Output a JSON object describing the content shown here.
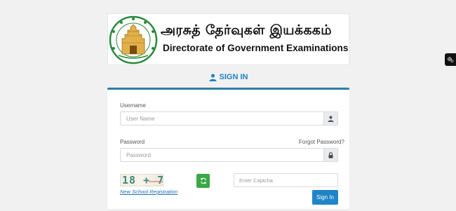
{
  "header": {
    "title_tamil": "அரசுத் தேர்வுகள் இயக்ககம்",
    "title_english": "Directorate of Government Examinations"
  },
  "signin": {
    "heading": "SIGN IN",
    "username_label": "Username",
    "username_placeholder": "User Name",
    "username_value": "",
    "password_label": "Password",
    "password_placeholder": "Password",
    "password_value": "",
    "forgot_password": "Forgot Password?",
    "captcha_text": "18 + 7 =",
    "captcha_placeholder": "Enter Captcha",
    "captcha_value": "",
    "registration_link": "New School Registration",
    "submit_label": "Sign In"
  },
  "icons": {
    "heading": "user-icon",
    "username_addon": "user-icon",
    "password_addon": "lock-icon",
    "refresh": "refresh-icon",
    "settings": "gears-icon",
    "logo": "temple-emblem"
  },
  "colors": {
    "accent": "#1f85c7",
    "panel_border": "#2f7ea8",
    "refresh": "#39a845",
    "heading": "#1f7fc6"
  }
}
